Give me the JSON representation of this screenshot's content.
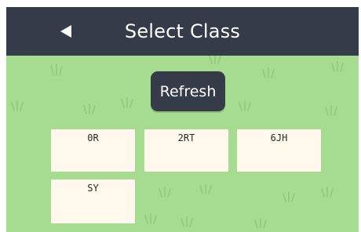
{
  "header": {
    "title": "Select Class",
    "back_icon": "back-arrow-icon"
  },
  "refresh_label": "Refresh",
  "classes": [
    {
      "label": "0R"
    },
    {
      "label": "2RT"
    },
    {
      "label": "6JH"
    },
    {
      "label": "SY"
    }
  ],
  "colors": {
    "header": "#363b49",
    "grass": "#a6dc8f",
    "card": "#fff8ec"
  }
}
